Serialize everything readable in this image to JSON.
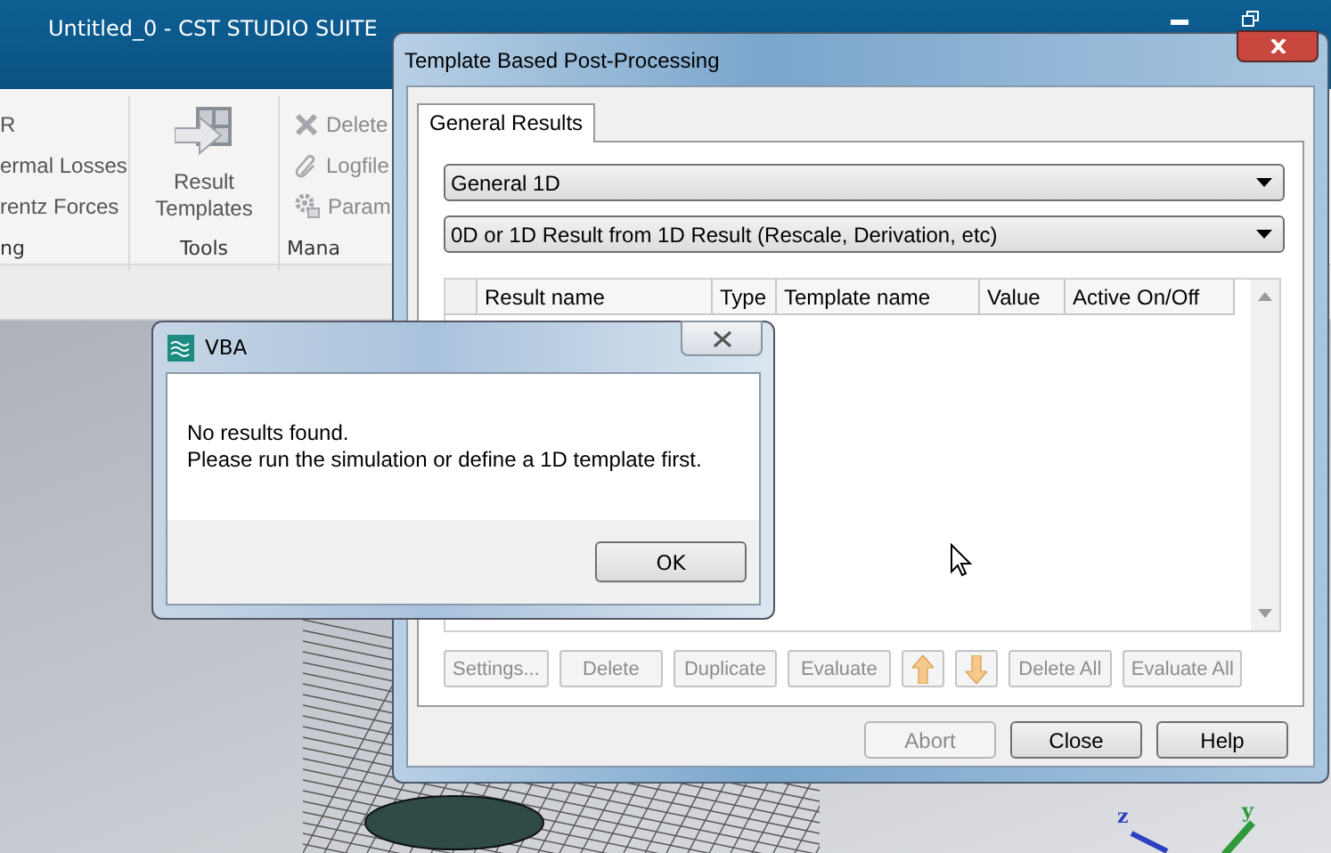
{
  "app": {
    "title": "Untitled_0 - CST STUDIO SUITE",
    "ribbon": [
      {
        "label": "ng",
        "kind": "small",
        "items": [
          {
            "text": "R",
            "disabled": false
          },
          {
            "text": "ermal Losses",
            "disabled": false
          },
          {
            "text": "rentz Forces",
            "disabled": false
          }
        ]
      },
      {
        "label": "Tools",
        "kind": "large",
        "items": [
          {
            "text": "Result Templates",
            "disabled": false
          }
        ]
      },
      {
        "label": "Mana",
        "kind": "small",
        "items": [
          {
            "text": "Delete",
            "disabled": true
          },
          {
            "text": "Logfile",
            "disabled": true
          },
          {
            "text": "Param",
            "disabled": true
          }
        ]
      }
    ]
  },
  "template_dialog": {
    "title": "Template Based Post-Processing",
    "tabs": [
      {
        "label": "General Results",
        "selected": true
      }
    ],
    "dropdowns": [
      "General 1D",
      "0D or 1D Result from 1D Result (Rescale, Derivation, etc)"
    ],
    "table": {
      "columns": [
        "Result name",
        "Type",
        "Template name",
        "Value",
        "Active On/Off"
      ]
    },
    "actions": [
      {
        "kind": "text",
        "label": "Settings...",
        "disabled": true
      },
      {
        "kind": "text",
        "label": "Delete",
        "disabled": true
      },
      {
        "kind": "text",
        "label": "Duplicate",
        "disabled": true
      },
      {
        "kind": "text",
        "label": "Evaluate",
        "disabled": true
      },
      {
        "kind": "up",
        "disabled": true
      },
      {
        "kind": "down",
        "disabled": true
      },
      {
        "kind": "text",
        "label": "Delete All",
        "disabled": true
      },
      {
        "kind": "text",
        "label": "Evaluate All",
        "disabled": true
      }
    ],
    "footer_buttons": [
      {
        "label": "Abort",
        "disabled": true
      },
      {
        "label": "Close",
        "disabled": false
      },
      {
        "label": "Help",
        "disabled": false
      }
    ]
  },
  "vba_dialog": {
    "title": "VBA",
    "message": [
      "No results found.",
      "Please run the simulation or define a 1D template first."
    ],
    "button": "OK"
  },
  "axes": {
    "labels": [
      "z",
      "y"
    ]
  }
}
